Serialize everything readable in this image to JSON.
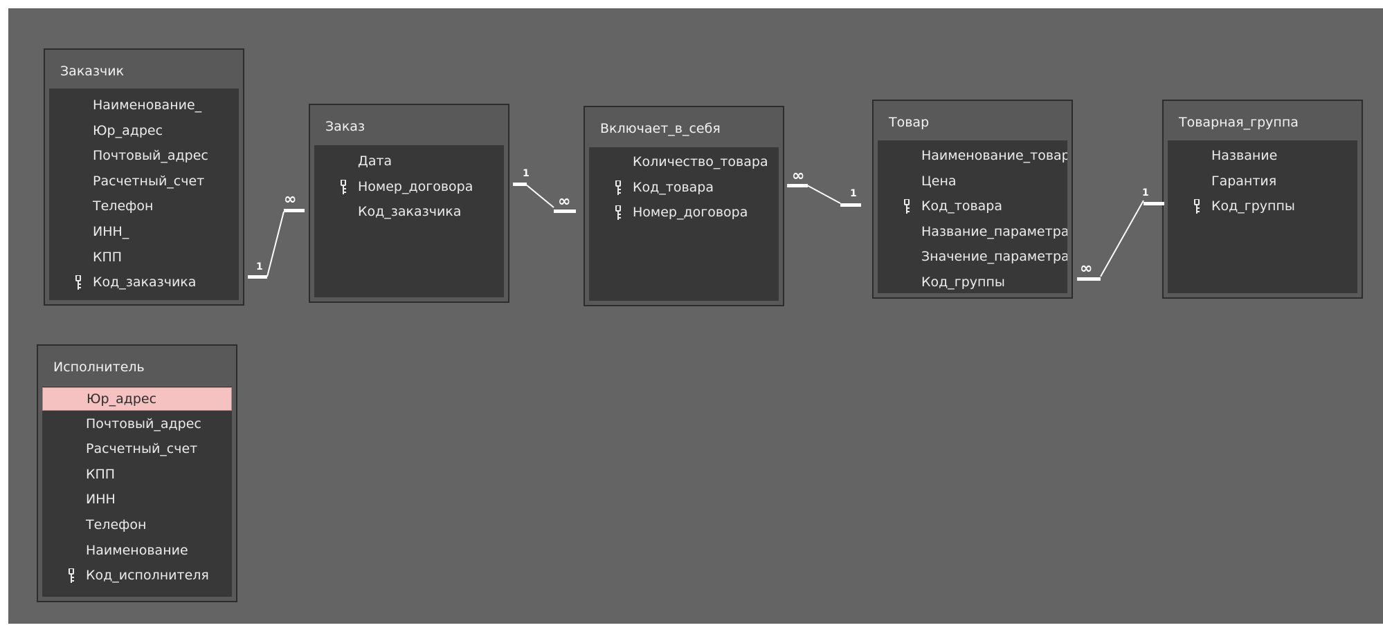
{
  "tables": {
    "customer": {
      "title": "Заказчик",
      "fields": [
        {
          "name": "Наименование_",
          "key": false
        },
        {
          "name": "Юр_адрес",
          "key": false
        },
        {
          "name": "Почтовый_адрес",
          "key": false
        },
        {
          "name": "Расчетный_счет",
          "key": false
        },
        {
          "name": "Телефон",
          "key": false
        },
        {
          "name": "ИНН_",
          "key": false
        },
        {
          "name": "КПП",
          "key": false
        },
        {
          "name": "Код_заказчика",
          "key": true
        }
      ]
    },
    "order": {
      "title": "Заказ",
      "fields": [
        {
          "name": "Дата",
          "key": false
        },
        {
          "name": "Номер_договора",
          "key": true
        },
        {
          "name": "Код_заказчика",
          "key": false
        }
      ]
    },
    "includes": {
      "title": "Включает_в_себя",
      "fields": [
        {
          "name": "Количество_товара",
          "key": false
        },
        {
          "name": "Код_товара",
          "key": true
        },
        {
          "name": "Номер_договора",
          "key": true
        }
      ]
    },
    "product": {
      "title": "Товар",
      "fields": [
        {
          "name": "Наименование_товара",
          "key": false
        },
        {
          "name": "Цена",
          "key": false
        },
        {
          "name": "Код_товара",
          "key": true
        },
        {
          "name": "Название_параметра",
          "key": false
        },
        {
          "name": "Значение_параметра",
          "key": false
        },
        {
          "name": "Код_группы",
          "key": false
        }
      ]
    },
    "product_group": {
      "title": "Товарная_группа",
      "fields": [
        {
          "name": "Название",
          "key": false
        },
        {
          "name": "Гарантия",
          "key": false
        },
        {
          "name": "Код_группы",
          "key": true
        }
      ]
    },
    "executor": {
      "title": "Исполнитель",
      "fields": [
        {
          "name": "Юр_адрес",
          "key": false,
          "selected": true
        },
        {
          "name": "Почтовый_адрес",
          "key": false
        },
        {
          "name": "Расчетный_счет",
          "key": false
        },
        {
          "name": "КПП",
          "key": false
        },
        {
          "name": "ИНН",
          "key": false
        },
        {
          "name": "Телефон",
          "key": false
        },
        {
          "name": "Наименование",
          "key": false
        },
        {
          "name": "Код_исполнителя",
          "key": true
        }
      ]
    }
  },
  "relationships": [
    {
      "from": "customer",
      "to": "order",
      "from_label": "1",
      "to_label": "∞"
    },
    {
      "from": "order",
      "to": "includes",
      "from_label": "1",
      "to_label": "∞"
    },
    {
      "from": "includes",
      "to": "product",
      "from_label": "∞",
      "to_label": "1"
    },
    {
      "from": "product",
      "to": "product_group",
      "from_label": "∞",
      "to_label": "1"
    }
  ],
  "colors": {
    "canvas": "#646464",
    "table_frame": "#595959",
    "field_list": "#383838",
    "selected_row": "#f5c1c1",
    "text": "#ececec",
    "line": "#ffffff"
  },
  "icons": {
    "primary_key": "key-icon"
  }
}
